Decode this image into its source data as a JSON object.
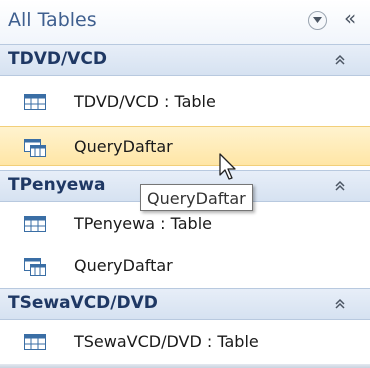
{
  "pane": {
    "title": "All Tables",
    "dropdown_icon": "dropdown-circle-icon",
    "shutter_icon": "double-chevron-left-icon",
    "shutter_glyph": "«"
  },
  "groups": [
    {
      "label": "TDVD/VCD",
      "items": [
        {
          "label": "TDVD/VCD : Table",
          "icon": "table-icon"
        },
        {
          "label": "QueryDaftar",
          "icon": "query-icon",
          "selected": true
        }
      ]
    },
    {
      "label": "TPenyewa",
      "items": [
        {
          "label": "TPenyewa : Table",
          "icon": "table-icon"
        },
        {
          "label": "QueryDaftar",
          "icon": "query-icon"
        }
      ]
    },
    {
      "label": "TSewaVCD/DVD",
      "items": [
        {
          "label": "TSewaVCD/DVD : Table",
          "icon": "table-icon"
        }
      ]
    }
  ],
  "tooltip": {
    "text": "QueryDaftar"
  },
  "colors": {
    "group_text": "#1f3864",
    "selection": "#ffe6a6",
    "title_text": "#3f5f8f"
  }
}
